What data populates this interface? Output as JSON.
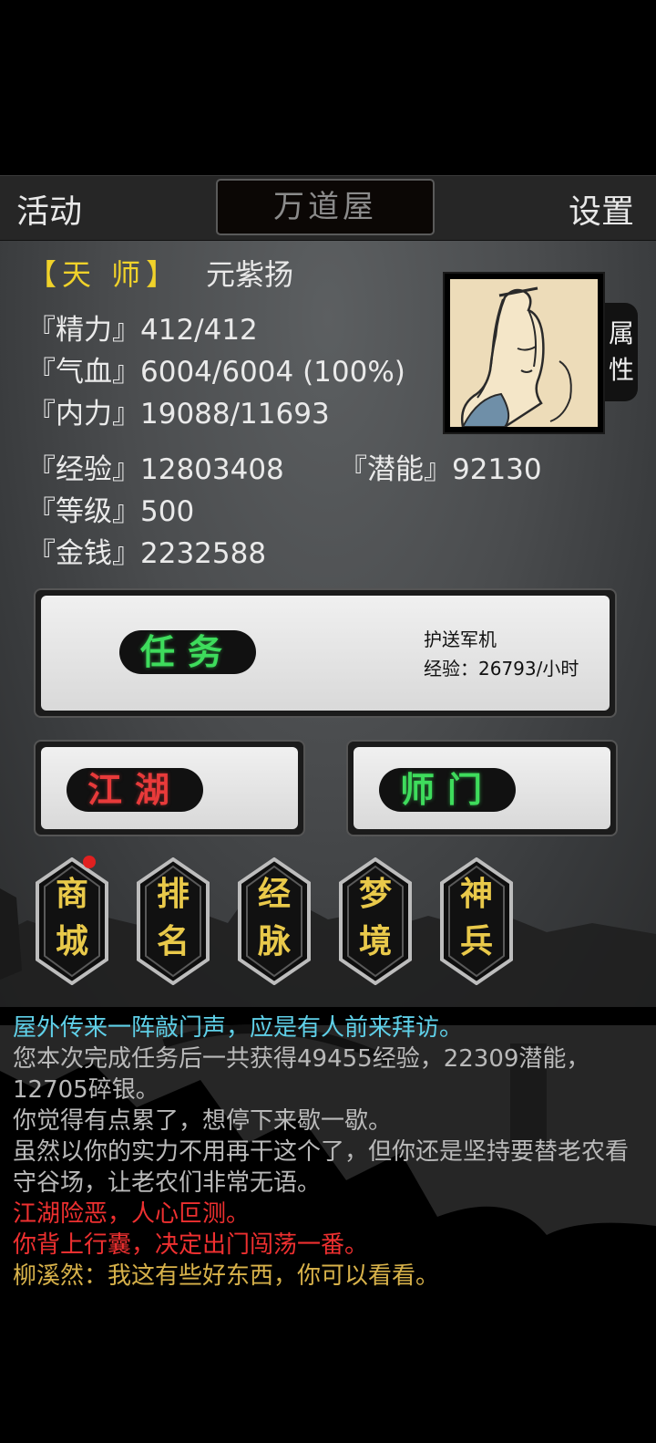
{
  "header": {
    "left": "活动",
    "center": "万道屋",
    "right": "设置"
  },
  "player": {
    "rank": "【天 师】",
    "name": "元紫扬"
  },
  "stats": {
    "jingli": "『精力』412/412",
    "qixue": "『气血』6004/6004 (100%)",
    "neili": "『内力』19088/11693",
    "jingyan": "『经验』12803408",
    "qianneng": "『潜能』92130",
    "dengji": "『等级』500",
    "jinqian": "『金钱』2232588"
  },
  "attr_tab": {
    "line1": "属",
    "line2": "性"
  },
  "buttons": {
    "task": "任务",
    "task_info_line1": "护送军机",
    "task_info_line2": "经验：26793/小时",
    "jianghu": "江湖",
    "shimen": "师门"
  },
  "badges": [
    {
      "top": "商",
      "bottom": "城",
      "has_dot": true
    },
    {
      "top": "排",
      "bottom": "名",
      "has_dot": false
    },
    {
      "top": "经",
      "bottom": "脉",
      "has_dot": false
    },
    {
      "top": "梦",
      "bottom": "境",
      "has_dot": false
    },
    {
      "top": "神",
      "bottom": "兵",
      "has_dot": false
    }
  ],
  "log": [
    {
      "text": "屋外传来一阵敲门声，应是有人前来拜访。",
      "color": "#5fd0e8"
    },
    {
      "text": "您本次完成任务后一共获得49455经验，22309潜能，12705碎银。",
      "color": "#b9b9b9"
    },
    {
      "text": "你觉得有点累了，想停下来歇一歇。",
      "color": "#b9b9b9"
    },
    {
      "text": "虽然以你的实力不用再干这个了，但你还是坚持要替老农看守谷场，让老农们非常无语。",
      "color": "#b9b9b9"
    },
    {
      "text": "江湖险恶，人心叵测。",
      "color": "#ee3030"
    },
    {
      "text": "你背上行囊，决定出门闯荡一番。",
      "color": "#ee3030"
    },
    {
      "text": "柳溪然：我这有些好东西，你可以看看。",
      "color": "#d8b24a"
    }
  ],
  "colors": {
    "rank": "#f0d22a",
    "green_text": "#3edc5c",
    "red_text": "#e83a3a",
    "badge_text": "#e9c94a"
  }
}
